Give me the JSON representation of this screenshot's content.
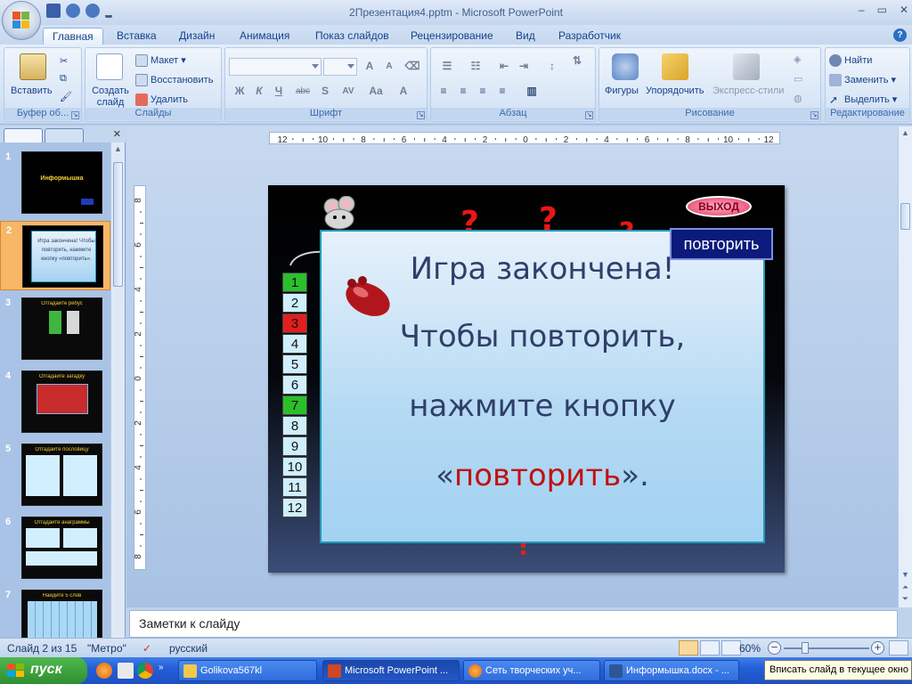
{
  "window": {
    "title": "2Презентация4.pptm - Microsoft PowerPoint",
    "controls": [
      "–",
      "▭",
      "✕"
    ]
  },
  "tabs": [
    "Главная",
    "Вставка",
    "Дизайн",
    "Анимация",
    "Показ слайдов",
    "Рецензирование",
    "Вид",
    "Разработчик"
  ],
  "active_tab": "Главная",
  "ribbon": {
    "clipboard": {
      "paste": "Вставить",
      "label": "Буфер об..."
    },
    "slides": {
      "new_slide": "Создать слайд",
      "layout": "Макет",
      "reset": "Восстановить",
      "delete": "Удалить",
      "label": "Слайды"
    },
    "font": {
      "label": "Шрифт",
      "buttons": [
        "Ж",
        "К",
        "Ч",
        "abc",
        "S",
        "AV",
        "Aa",
        "A"
      ]
    },
    "paragraph": {
      "label": "Абзац"
    },
    "drawing": {
      "shapes": "Фигуры",
      "arrange": "Упорядочить",
      "quick_styles": "Экспресс-стили",
      "label": "Рисование"
    },
    "editing": {
      "find": "Найти",
      "replace": "Заменить",
      "select": "Выделить",
      "label": "Редактирование"
    }
  },
  "ruler": {
    "h_labels": [
      "12",
      "10",
      "8",
      "6",
      "4",
      "2",
      "0",
      "2",
      "4",
      "6",
      "8",
      "10",
      "12"
    ],
    "v_labels": [
      "8",
      "6",
      "4",
      "2",
      "0",
      "2",
      "4",
      "6",
      "8"
    ]
  },
  "thumbnails": [
    {
      "num": "1",
      "title": "Информышка"
    },
    {
      "num": "2",
      "title": "Игра закончена! Чтобы повторить, нажмите кнопку «повторить»."
    },
    {
      "num": "3",
      "title": "Отгадайте ребус"
    },
    {
      "num": "4",
      "title": "Отгадайте загадку"
    },
    {
      "num": "5",
      "title": "Отгадайте пословицу"
    },
    {
      "num": "6",
      "title": "Отгадайте анаграммы"
    },
    {
      "num": "7",
      "title": "Найдите 5 слов"
    }
  ],
  "slide": {
    "exit_label": "ВЫХОД",
    "repeat_label": "повторить",
    "question_marks": [
      "?",
      "?",
      "?"
    ],
    "numbers": [
      "1",
      "2",
      "3",
      "4",
      "5",
      "6",
      "7",
      "8",
      "9",
      "10",
      "11",
      "12"
    ],
    "line1": "Игра закончена!",
    "line2": "Чтобы повторить,",
    "line3": "нажмите кнопку",
    "line4_open": "«",
    "line4_word": "повторить",
    "line4_close": "».",
    "colors": {
      "green": "#2bbf2b",
      "red": "#e01f1f",
      "light": "#cfeffc"
    }
  },
  "notes_placeholder": "Заметки к слайду",
  "status": {
    "slide_info": "Слайд 2 из 15",
    "theme": "\"Метро\"",
    "language": "русский",
    "zoom": "60%"
  },
  "taskbar": {
    "start": "пуск",
    "tasks": [
      "Golikova567kl",
      "Microsoft PowerPoint ...",
      "Сеть творческих уч...",
      "Информышка.docx - ..."
    ],
    "tooltip": "Вписать слайд в текущее окно"
  }
}
